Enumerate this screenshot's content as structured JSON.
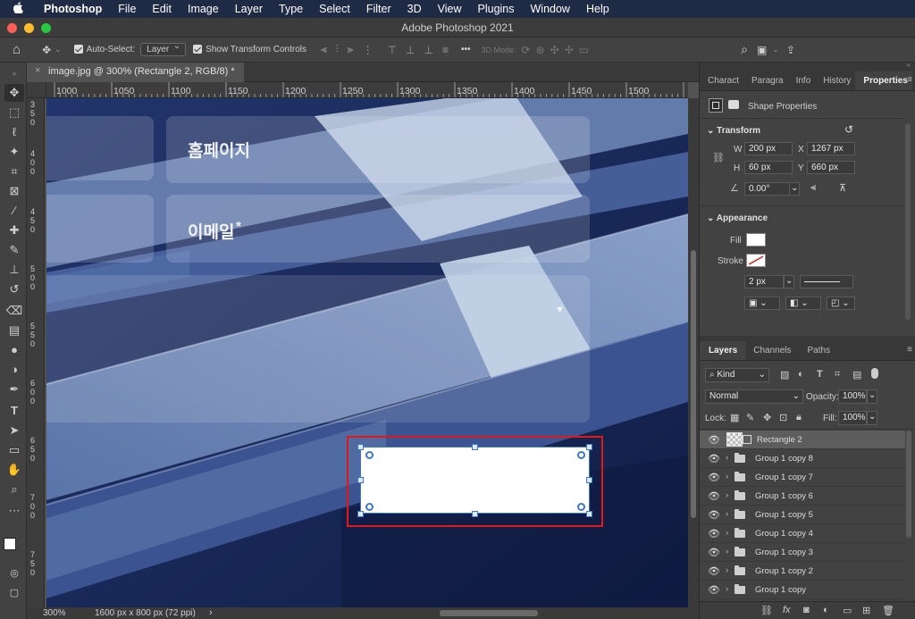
{
  "menubar": {
    "apple": "",
    "app_name": "Photoshop",
    "items": [
      "File",
      "Edit",
      "Image",
      "Layer",
      "Type",
      "Select",
      "Filter",
      "3D",
      "View",
      "Plugins",
      "Window",
      "Help"
    ]
  },
  "titlebar": {
    "title": "Adobe Photoshop 2021"
  },
  "options": {
    "auto_select_label": "Auto-Select:",
    "auto_select_value": "Layer",
    "show_transform_label": "Show Transform Controls",
    "mode_3d_label": "3D Mode:",
    "more_label": "•••"
  },
  "document": {
    "tab_title": "image.jpg @ 300% (Rectangle 2, RGB/8) *",
    "close": "×"
  },
  "ruler": {
    "h_ticks": [
      "1000",
      "1050",
      "1100",
      "1150",
      "1200",
      "1250",
      "1300",
      "1350",
      "1400",
      "1450",
      "1500"
    ],
    "v_ticks": [
      "3 5 0",
      "4 0 0",
      "4 5 0",
      "5 0 0",
      "5 5 0",
      "6 0 0",
      "6 5 0",
      "7 0 0",
      "7 5 0"
    ]
  },
  "canvas": {
    "field_homepage": "홈페이지",
    "field_email": "이메일",
    "required_mark": "*",
    "dropdown_arrow": "▼"
  },
  "status": {
    "zoom": "300%",
    "doc_info": "1600 px x 800 px (72 ppi)",
    "arrow": "›"
  },
  "panel_tabs": [
    "Charact",
    "Paragra",
    "Info",
    "History",
    "Properties"
  ],
  "properties": {
    "kind_label": "Shape Properties",
    "transform_header": "Transform",
    "w_label": "W",
    "w_value": "200 px",
    "x_label": "X",
    "x_value": "1267 px",
    "h_label": "H",
    "h_value": "60 px",
    "y_label": "Y",
    "y_value": "660 px",
    "angle_value": "0.00°",
    "appearance_header": "Appearance",
    "fill_label": "Fill",
    "stroke_label": "Stroke",
    "stroke_width": "2 px"
  },
  "layers_tabs": [
    "Layers",
    "Channels",
    "Paths"
  ],
  "layers_panel": {
    "kind_filter": "Kind",
    "blend_mode": "Normal",
    "opacity_label": "Opacity:",
    "opacity_value": "100%",
    "lock_label": "Lock:",
    "fill_label": "Fill:",
    "fill_value": "100%",
    "layers": [
      {
        "name": "Rectangle 2",
        "type": "shape",
        "selected": true
      },
      {
        "name": "Group 1 copy 8",
        "type": "group"
      },
      {
        "name": "Group 1 copy 7",
        "type": "group"
      },
      {
        "name": "Group 1 copy 6",
        "type": "group"
      },
      {
        "name": "Group 1 copy 5",
        "type": "group"
      },
      {
        "name": "Group 1 copy 4",
        "type": "group"
      },
      {
        "name": "Group 1 copy 3",
        "type": "group"
      },
      {
        "name": "Group 1 copy 2",
        "type": "group"
      },
      {
        "name": "Group 1 copy",
        "type": "group"
      }
    ]
  },
  "colors": {
    "selection_outline": "#e01818",
    "canvas_bg": "#1a2a58",
    "shape_fill": "#ffffff"
  }
}
